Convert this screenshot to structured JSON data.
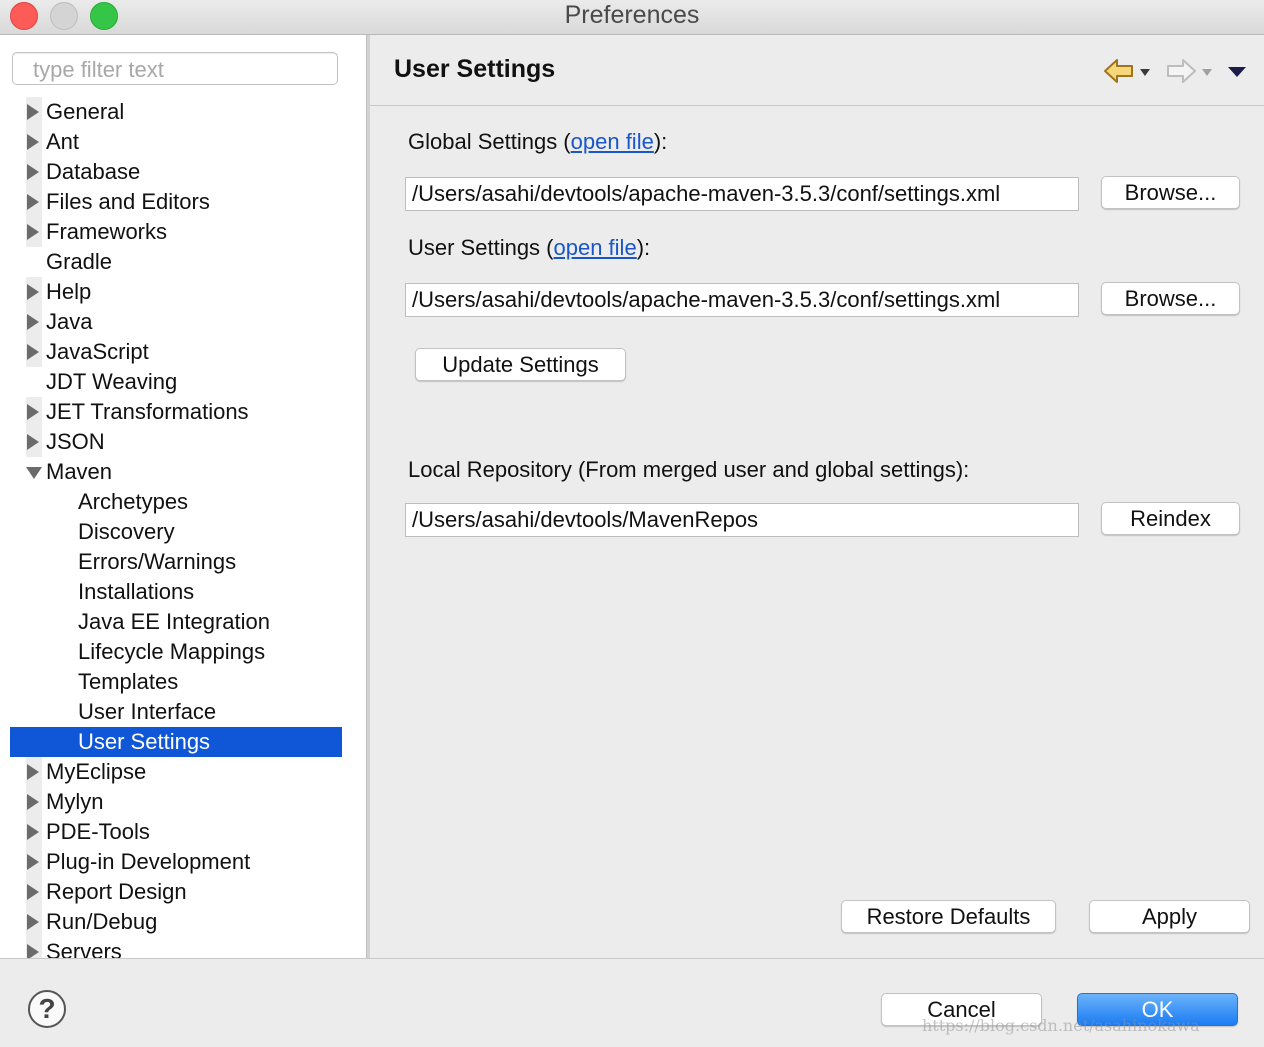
{
  "window": {
    "title": "Preferences"
  },
  "filter": {
    "placeholder": "type filter text"
  },
  "tree": {
    "items": [
      {
        "label": "General",
        "state": "collapsed"
      },
      {
        "label": "Ant",
        "state": "collapsed"
      },
      {
        "label": "Database",
        "state": "collapsed"
      },
      {
        "label": "Files and Editors",
        "state": "collapsed"
      },
      {
        "label": "Frameworks",
        "state": "collapsed"
      },
      {
        "label": "Gradle",
        "state": "leaf"
      },
      {
        "label": "Help",
        "state": "collapsed"
      },
      {
        "label": "Java",
        "state": "collapsed"
      },
      {
        "label": "JavaScript",
        "state": "collapsed"
      },
      {
        "label": "JDT Weaving",
        "state": "leaf"
      },
      {
        "label": "JET Transformations",
        "state": "collapsed"
      },
      {
        "label": "JSON",
        "state": "collapsed"
      },
      {
        "label": "Maven",
        "state": "expanded"
      },
      {
        "label": "Archetypes",
        "state": "child"
      },
      {
        "label": "Discovery",
        "state": "child"
      },
      {
        "label": "Errors/Warnings",
        "state": "child"
      },
      {
        "label": "Installations",
        "state": "child"
      },
      {
        "label": "Java EE Integration",
        "state": "child"
      },
      {
        "label": "Lifecycle Mappings",
        "state": "child"
      },
      {
        "label": "Templates",
        "state": "child"
      },
      {
        "label": "User Interface",
        "state": "child"
      },
      {
        "label": "User Settings",
        "state": "child-selected"
      },
      {
        "label": "MyEclipse",
        "state": "collapsed"
      },
      {
        "label": "Mylyn",
        "state": "collapsed"
      },
      {
        "label": "PDE-Tools",
        "state": "collapsed"
      },
      {
        "label": "Plug-in Development",
        "state": "collapsed"
      },
      {
        "label": "Report Design",
        "state": "collapsed"
      },
      {
        "label": "Run/Debug",
        "state": "collapsed"
      },
      {
        "label": "Servers",
        "state": "collapsed"
      }
    ]
  },
  "page": {
    "title": "User Settings",
    "global": {
      "label_prefix": "Global Settings (",
      "link": "open file",
      "label_suffix": "):",
      "path": "/Users/asahi/devtools/apache-maven-3.5.3/conf/settings.xml",
      "browse": "Browse..."
    },
    "user": {
      "label_prefix": "User Settings (",
      "link": "open file",
      "label_suffix": "):",
      "path": "/Users/asahi/devtools/apache-maven-3.5.3/conf/settings.xml",
      "browse": "Browse..."
    },
    "update_button": "Update Settings",
    "local": {
      "label": "Local Repository (From merged user and global settings):",
      "path": "/Users/asahi/devtools/MavenRepos",
      "reindex": "Reindex"
    },
    "restore_button": "Restore Defaults",
    "apply_button": "Apply"
  },
  "dialog": {
    "help_glyph": "?",
    "cancel": "Cancel",
    "ok": "OK"
  },
  "watermark": "https://blog.csdn.net/asahinokawa",
  "colors": {
    "selection": "#0f57d7",
    "link": "#1a56c9",
    "ok_button": "#1a7cf3"
  }
}
